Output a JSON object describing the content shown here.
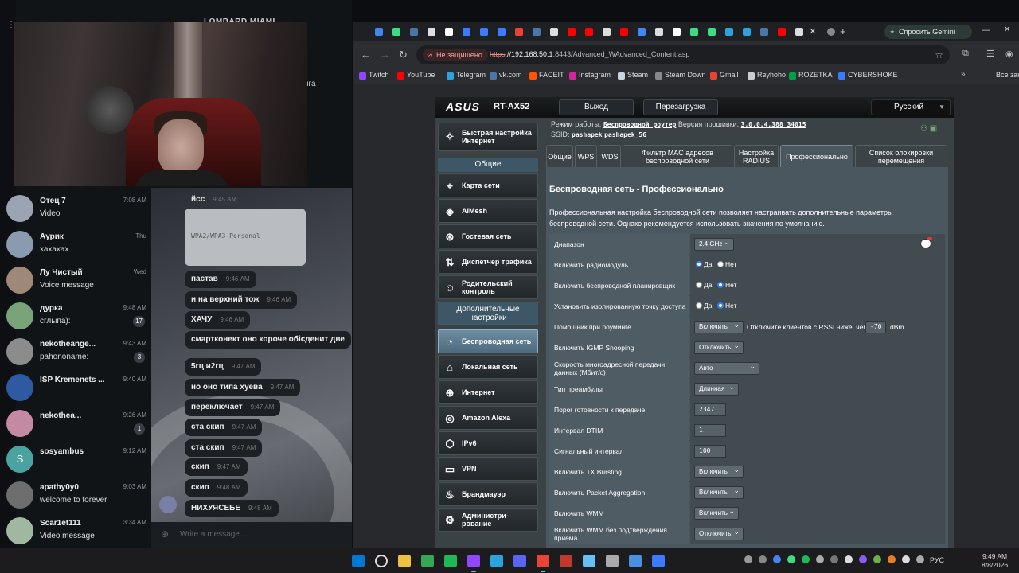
{
  "telegram": {
    "top_chat_title": "LOMBARD MIAMI",
    "right_label": "нга",
    "chats": [
      {
        "name": "Отец 7",
        "preview": "Video",
        "time": "7:08 AM",
        "color": "#9aa4b2"
      },
      {
        "name": "Аурик",
        "preview": "хахахах",
        "time": "Thu",
        "color": "#8a9bb0"
      },
      {
        "name": "Лу Чистый",
        "preview": "Voice message",
        "time": "Wed",
        "color": "#a08878"
      },
      {
        "name": "дурка",
        "preview": "сглыпа):",
        "time": "9:48 AM",
        "badge": "17",
        "color": "#7aa37a"
      },
      {
        "name": "nekotheange...",
        "preview": "pahononame:",
        "time": "9:43 AM",
        "badge": "3",
        "color": "#8c8c8c"
      },
      {
        "name": "ISP Kremenets ...",
        "preview": "",
        "time": "9:40 AM",
        "color": "#2d5aa0"
      },
      {
        "name": "nekothea...",
        "preview": "",
        "time": "9:26 AM",
        "badge": "1",
        "color": "#c58aa3"
      },
      {
        "name": "sosyambus",
        "preview": "",
        "time": "9:12 AM",
        "color": "#4aa3a0"
      },
      {
        "name": "apathy0y0",
        "preview": "welcome to forever",
        "time": "9:03 AM",
        "color": "#6e6e6e"
      },
      {
        "name": "Scar1et111",
        "preview": "Video message",
        "time": "3:34 AM",
        "color": "#a0b8a0"
      }
    ],
    "avatar_letter": "S",
    "messages": [
      {
        "text": "йсс",
        "time": "9:45 AM"
      },
      {
        "text": "пастав",
        "time": "9:46 AM"
      },
      {
        "text": "и на верхний тож",
        "time": "9:46 AM"
      },
      {
        "text": "ХАЧУ",
        "time": "9:46 AM"
      },
      {
        "text": "смартконект оно короче обієденит две",
        "time": ""
      },
      {
        "text": "5гц и2гц",
        "time": "9:47 AM"
      },
      {
        "text": "но оно типа хуева",
        "time": "9:47 AM"
      },
      {
        "text": "переключает",
        "time": "9:47 AM"
      },
      {
        "text": "ста скип",
        "time": "9:47 AM"
      },
      {
        "text": "ста скип",
        "time": "9:47 AM"
      },
      {
        "text": "скип",
        "time": "9:47 AM"
      },
      {
        "text": "скип",
        "time": "9:48 AM"
      },
      {
        "text": "НИХУЯСЕБЕ",
        "time": "9:48 AM"
      }
    ],
    "image_caption": "WPA2/WPA3-Personal",
    "write_placeholder": "Write a message..."
  },
  "browser": {
    "gemini_label": "Спросить Gemini",
    "not_secure": "Не защищено",
    "url_scheme": "https",
    "url_host": "://192.168.50.1",
    "url_rest": ":8443/Advanced_WAdvanced_Content.asp",
    "bookmarks": [
      {
        "label": "Twitch",
        "color": "#9146ff"
      },
      {
        "label": "YouTube",
        "color": "#ff0000"
      },
      {
        "label": "Telegram",
        "color": "#2aa3df"
      },
      {
        "label": "vk.com",
        "color": "#4a76a8"
      },
      {
        "label": "FACEIT",
        "color": "#ff5500"
      },
      {
        "label": "Instagram",
        "color": "#d6249f"
      },
      {
        "label": "Steam",
        "color": "#c7d5e0"
      },
      {
        "label": "Steam Down",
        "color": "#888888"
      },
      {
        "label": "Gmail",
        "color": "#ea4335"
      },
      {
        "label": "Reyhoho",
        "color": "#cccccc"
      },
      {
        "label": "ROZETKA",
        "color": "#00a046"
      },
      {
        "label": "CYBERSHOKE",
        "color": "#3b7bff"
      }
    ],
    "all_bookmarks": "Все закл"
  },
  "router": {
    "logo": "ASUS",
    "model": "RT-AX52",
    "logout": "Выход",
    "reboot": "Перезагрузка",
    "language": "Русский",
    "mode_label": "Режим работы:",
    "mode_value": "Беспроводной роутер",
    "fw_label": "Версия прошивки:",
    "fw_value": "3.0.0.4.388_34015",
    "ssid_label": "SSID:",
    "ssid_1": "pashapek",
    "ssid_2": "pashapek_5G",
    "quick_setup": "Быстрая настройка Интернет",
    "general_group": "Общие",
    "general_items": [
      "Карта сети",
      "AiMesh",
      "Гостевая сеть",
      "Диспетчер трафика",
      "Родительский контроль"
    ],
    "advanced_group": "Дополнительные настройки",
    "advanced_items": [
      "Беспроводная сеть",
      "Локальная сеть",
      "Интернет",
      "Amazon Alexa",
      "IPv6",
      "VPN",
      "Брандмауэр",
      "Администри-рование"
    ],
    "tabs": [
      "Общие",
      "WPS",
      "WDS",
      "Фильтр MAC адресов беспроводной сети",
      "Настройка RADIUS",
      "Профессионально",
      "Список блокировки перемещения"
    ],
    "title": "Беспроводная сеть - Профессионально",
    "description": "Профессиональная настройка беспроводной сети позволяет настраивать дополнительные параметры беспроводной сети. Однако рекомендуется использовать значения по умолчанию.",
    "rows": {
      "band": {
        "label": "Диапазон",
        "value": "2.4 GHz"
      },
      "radio": {
        "label": "Включить радиомодуль",
        "yes": "Да",
        "no": "Нет"
      },
      "scheduler": {
        "label": "Включить беспроводной планировщик",
        "yes": "Да",
        "no": "Нет"
      },
      "ap_isolation": {
        "label": "Установить изолированную точку доступа",
        "yes": "Да",
        "no": "Нет"
      },
      "roaming": {
        "label": "Помощник при роуминге",
        "value": "Включить",
        "hint": "Отключите клиентов с RSSI ниже, чем :",
        "rssi": "-70",
        "unit": "dBm"
      },
      "igmp": {
        "label": "Включить IGMP Snooping",
        "value": "Отключить"
      },
      "multicast": {
        "label": "Скорость многоадресной передачи данных (Мбит/с)",
        "value": "Авто"
      },
      "preamble": {
        "label": "Тип преамбулы",
        "value": "Длинная"
      },
      "rts": {
        "label": "Порог готовности к передаче",
        "value": "2347"
      },
      "dtim": {
        "label": "Интервал DTIM",
        "value": "1"
      },
      "beacon": {
        "label": "Сигнальный интервал",
        "value": "100"
      },
      "tx_bursting": {
        "label": "Включить TX Bursting",
        "value": "Включить"
      },
      "packet_agg": {
        "label": "Включить Packet Aggregation",
        "value": "Включить"
      },
      "wmm": {
        "label": "Включить WMM",
        "value": "Включить"
      },
      "wmm_noack": {
        "label": "Включить WMM без подтверждения приема",
        "value": "Отключить"
      }
    }
  },
  "taskbar": {
    "lang": "РУС",
    "time": "9:49 AM",
    "date": "8/8/2026"
  }
}
